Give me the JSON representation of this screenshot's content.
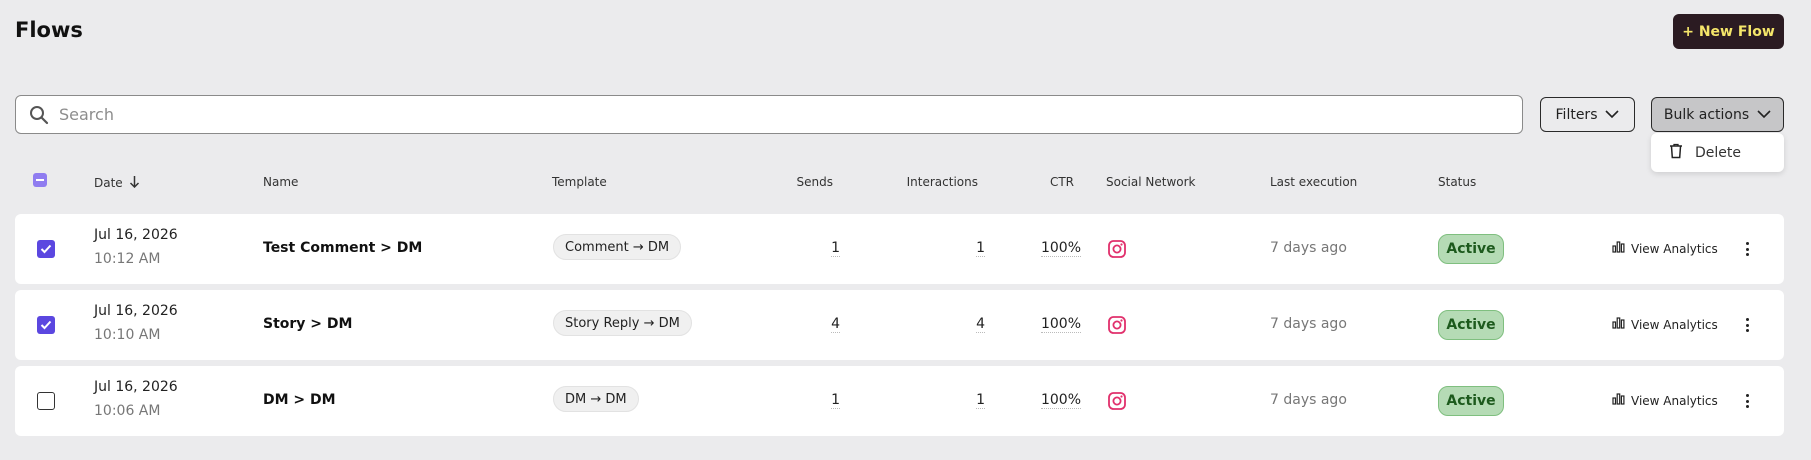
{
  "header": {
    "title": "Flows",
    "new_flow_label": "+ New Flow"
  },
  "toolbar": {
    "search_placeholder": "Search",
    "filters_label": "Filters",
    "bulk_actions_label": "Bulk actions",
    "bulk_menu": {
      "delete_label": "Delete"
    }
  },
  "table": {
    "columns": {
      "date": "Date",
      "name": "Name",
      "template": "Template",
      "sends": "Sends",
      "interactions": "Interactions",
      "ctr": "CTR",
      "social_network": "Social Network",
      "last_execution": "Last execution",
      "status": "Status"
    },
    "rows": [
      {
        "checked": true,
        "date": "Jul 16, 2026",
        "time": "10:12 AM",
        "name": "Test Comment > DM",
        "template": "Comment → DM",
        "sends": "1",
        "interactions": "1",
        "ctr": "100%",
        "social_icon": "instagram-icon",
        "last_execution": "7 days ago",
        "status": "Active",
        "action": "View Analytics"
      },
      {
        "checked": true,
        "date": "Jul 16, 2026",
        "time": "10:10 AM",
        "name": "Story > DM",
        "template": "Story Reply → DM",
        "sends": "4",
        "interactions": "4",
        "ctr": "100%",
        "social_icon": "instagram-icon",
        "last_execution": "7 days ago",
        "status": "Active",
        "action": "View Analytics"
      },
      {
        "checked": false,
        "date": "Jul 16, 2026",
        "time": "10:06 AM",
        "name": "DM > DM",
        "template": "DM → DM",
        "sends": "1",
        "interactions": "1",
        "ctr": "100%",
        "social_icon": "instagram-icon",
        "last_execution": "7 days ago",
        "status": "Active",
        "action": "View Analytics"
      }
    ]
  },
  "colors": {
    "background": "#ebebed",
    "primary_button": "#2b1b22",
    "primary_button_text": "#f5e66a",
    "checkbox_accent": "#5b47e0",
    "status_active_bg": "#b5dbb5",
    "instagram": "#e1306c"
  }
}
